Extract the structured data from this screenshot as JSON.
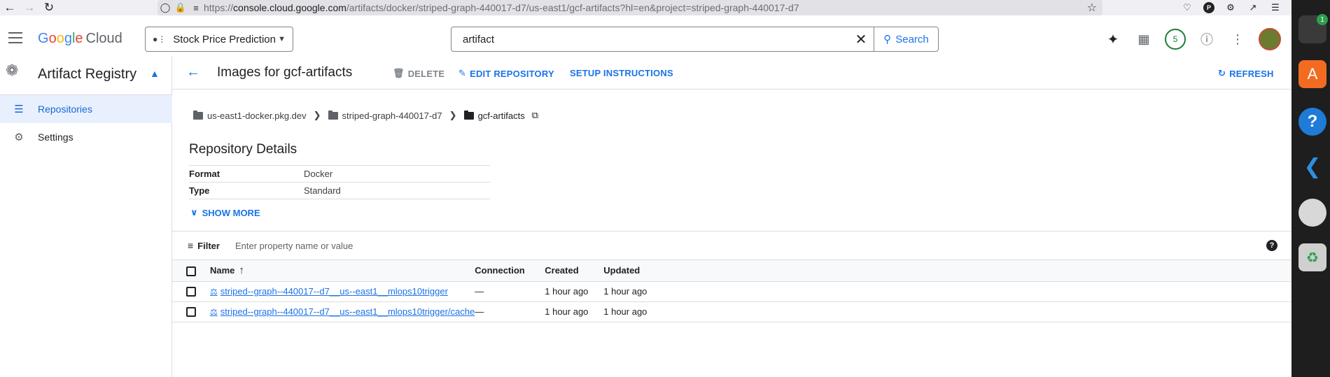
{
  "browser": {
    "url_scheme": "https://",
    "url_host": "console.cloud.google.com",
    "url_path": "/artifacts/docker/striped-graph-440017-d7/us-east1/gcf-artifacts?hl=en&project=striped-graph-440017-d7",
    "profile_letter": "P"
  },
  "dock": {
    "badge_count": "1"
  },
  "header": {
    "brand_google": [
      "G",
      "o",
      "o",
      "g",
      "l",
      "e"
    ],
    "brand_cloud": "Cloud",
    "project": "Stock Price Prediction",
    "search_value": "artifact",
    "search_button": "Search",
    "notifications_count": "5"
  },
  "sidebar": {
    "product": "Artifact Registry",
    "items": [
      {
        "label": "Repositories",
        "active": true
      },
      {
        "label": "Settings",
        "active": false
      }
    ]
  },
  "toolbar": {
    "title": "Images for gcf-artifacts",
    "delete_label": "DELETE",
    "edit_label": "EDIT REPOSITORY",
    "setup_label": "SETUP INSTRUCTIONS",
    "refresh_label": "REFRESH"
  },
  "breadcrumb": [
    "us-east1-docker.pkg.dev",
    "striped-graph-440017-d7",
    "gcf-artifacts"
  ],
  "repository_details": {
    "title": "Repository Details",
    "rows": [
      {
        "key": "Format",
        "value": "Docker"
      },
      {
        "key": "Type",
        "value": "Standard"
      }
    ],
    "show_more": "SHOW MORE"
  },
  "filter": {
    "label": "Filter",
    "placeholder": "Enter property name or value"
  },
  "table": {
    "columns": [
      "Name",
      "Connection",
      "Created",
      "Updated"
    ],
    "rows": [
      {
        "name": "striped--graph--440017--d7__us--east1__mlops10trigger",
        "connection": "—",
        "created": "1 hour ago",
        "updated": "1 hour ago"
      },
      {
        "name": "striped--graph--440017--d7__us--east1__mlops10trigger/cache",
        "connection": "—",
        "created": "1 hour ago",
        "updated": "1 hour ago"
      }
    ]
  }
}
